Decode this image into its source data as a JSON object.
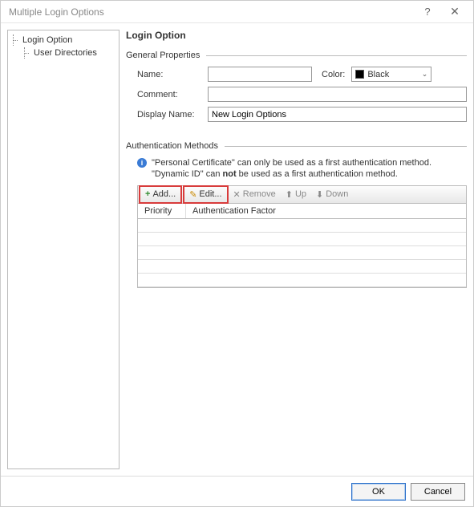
{
  "window": {
    "title": "Multiple Login Options",
    "help_icon": "?",
    "close_icon": "✕"
  },
  "sidebar": {
    "items": [
      {
        "label": "Login Option"
      },
      {
        "label": "User Directories"
      }
    ]
  },
  "main": {
    "heading": "Login Option",
    "general": {
      "title": "General Properties",
      "name_label": "Name:",
      "name_value": "",
      "color_label": "Color:",
      "color_value": "Black",
      "color_hex": "#000000",
      "comment_label": "Comment:",
      "comment_value": "",
      "displayname_label": "Display Name:",
      "displayname_value": "New Login Options"
    },
    "auth": {
      "title": "Authentication Methods",
      "info_line1_a": "\"Personal Certificate\" can only be used as a first authentication method.",
      "info_line2_a": "\"Dynamic ID\" can ",
      "info_line2_b": "not",
      "info_line2_c": " be used as a first authentication method.",
      "toolbar": {
        "add": "Add...",
        "edit": "Edit...",
        "remove": "Remove",
        "up": "Up",
        "down": "Down"
      },
      "grid": {
        "col_priority": "Priority",
        "col_factor": "Authentication Factor",
        "empty_rows": 5
      }
    }
  },
  "footer": {
    "ok": "OK",
    "cancel": "Cancel"
  }
}
